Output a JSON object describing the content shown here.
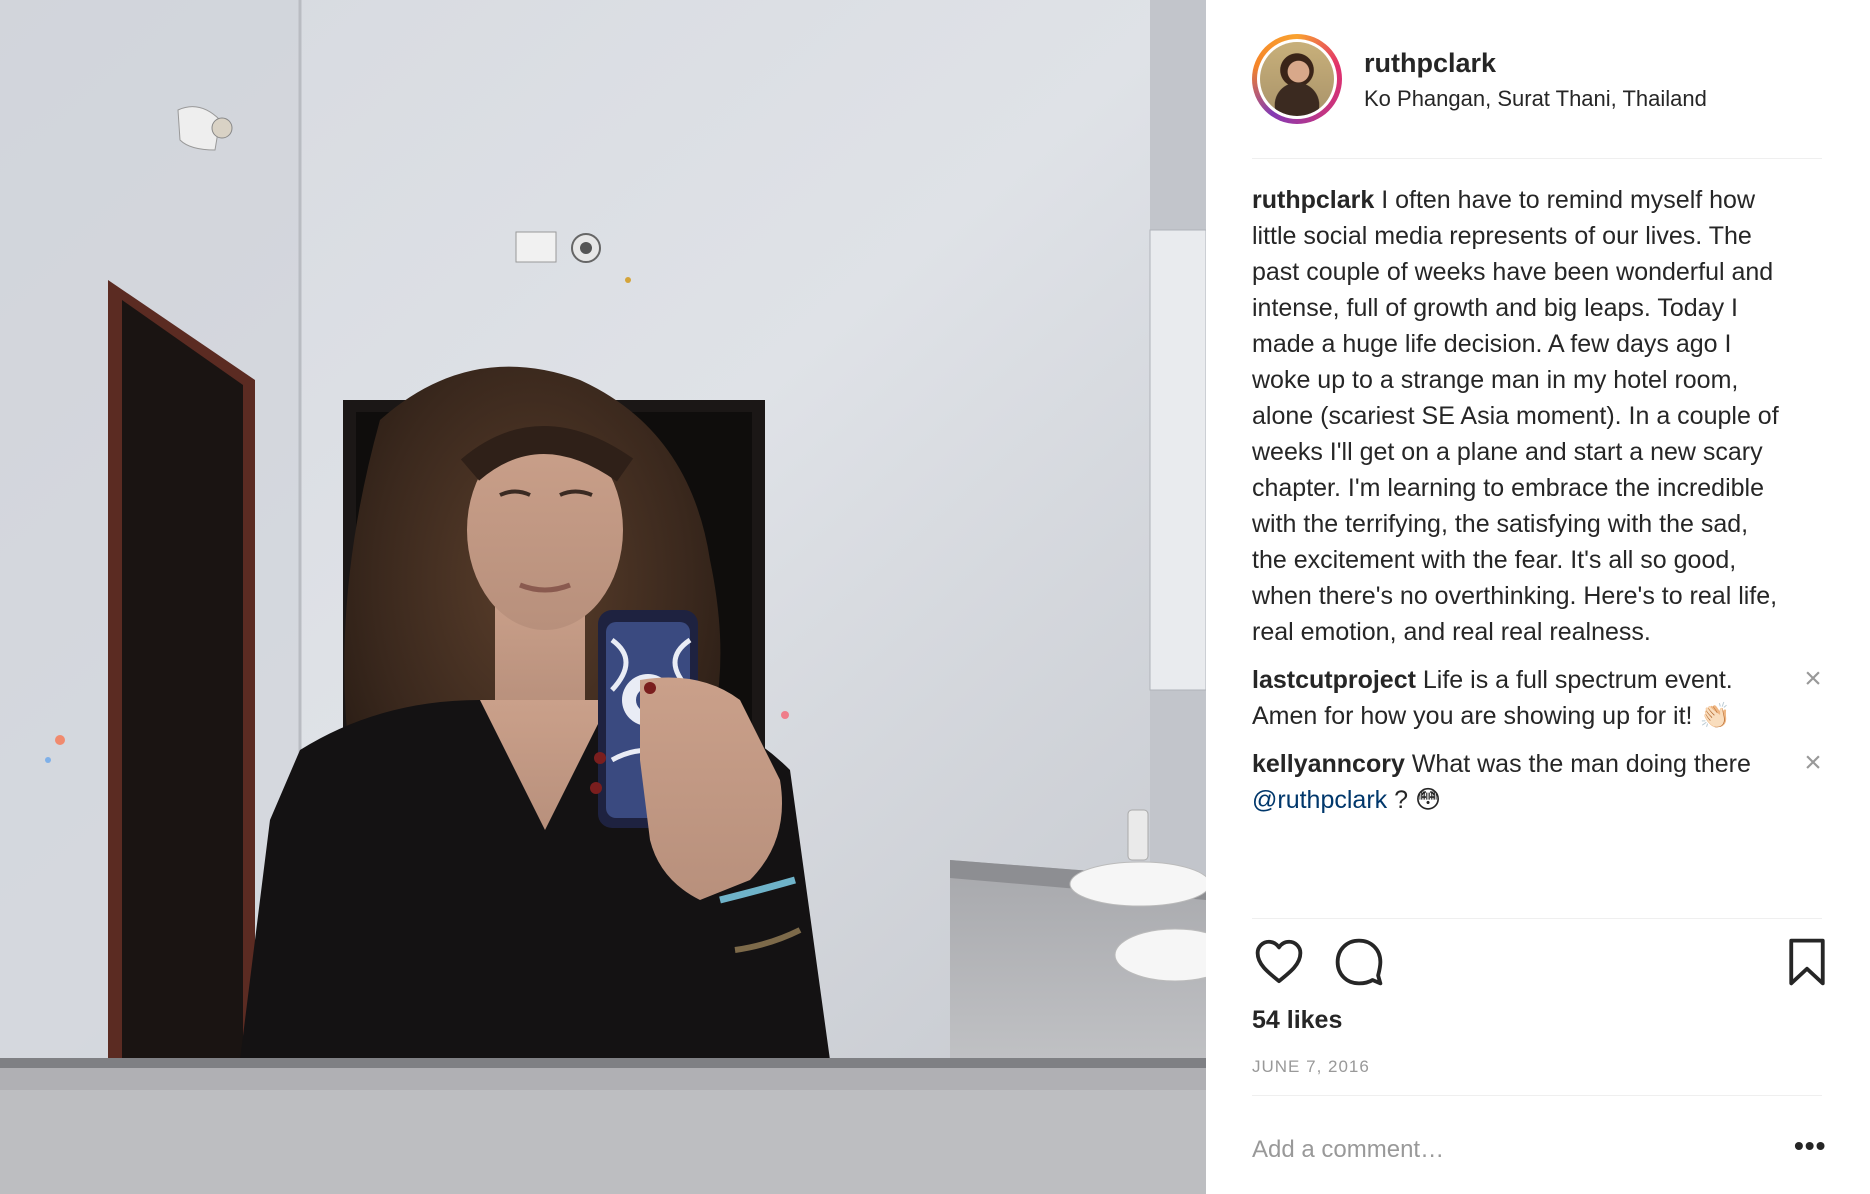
{
  "post": {
    "username": "ruthpclark",
    "location": "Ko Phangan, Surat Thani, Thailand"
  },
  "comments": [
    {
      "user": "ruthpclark",
      "text": "I often have to remind myself how little social media represents of our lives. The past couple of weeks have been wonderful and intense, full of growth and big leaps. Today I made a huge life decision. A few days ago I woke up to a strange man in my hotel room, alone (scariest SE Asia moment). In a couple of weeks I'll get on a plane and start a new scary chapter. I'm learning to embrace the incredible with the terrifying, the satisfying with the sad, the excitement with the fear. It's all so good, when there's no overthinking. Here's to real life, real emotion, and real real realness."
    },
    {
      "user": "lastcutproject",
      "text": "Life is a full spectrum event. Amen for how you are showing up for it! 👏🏻",
      "close": "×"
    },
    {
      "user": "kellyanncory",
      "text_before": "What was the man doing there",
      "mention": "@ruthpclark",
      "text_after": " ? 😳",
      "close": "×"
    }
  ],
  "likes": "54 likes",
  "date": "JUNE 7, 2016",
  "add_comment_placeholder": "Add a comment…",
  "more_label": "•••",
  "icons": {
    "like": "heart-icon",
    "comment": "comment-icon",
    "save": "bookmark-icon",
    "more": "more-options-icon"
  }
}
